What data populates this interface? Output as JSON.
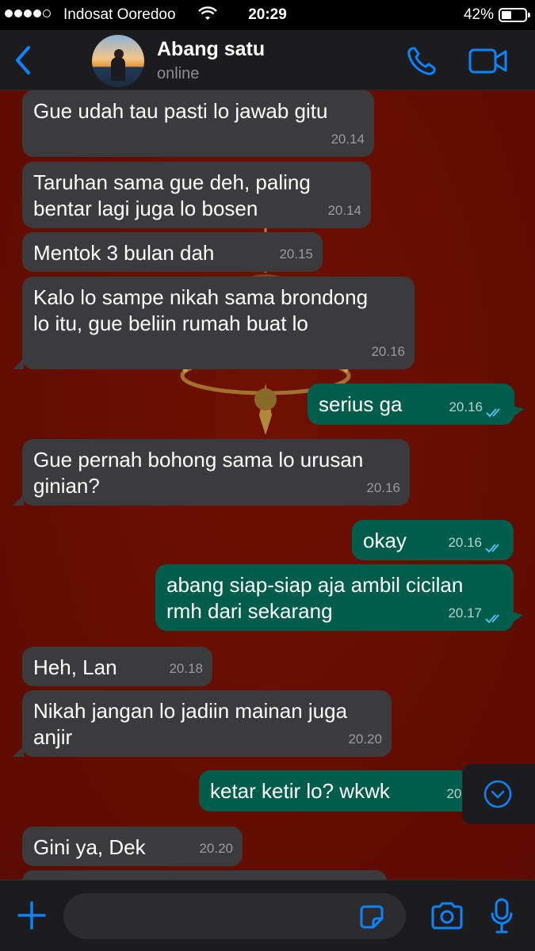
{
  "status_bar": {
    "carrier": "Indosat Ooredoo",
    "time": "20:29",
    "battery_pct": "42%"
  },
  "header": {
    "contact_name": "Abang satu",
    "contact_status": "online"
  },
  "messages": [
    {
      "dir": "in",
      "text": "Gue udah tau pasti lo jawab gitu",
      "time": "20.14"
    },
    {
      "dir": "in",
      "text": "Taruhan sama gue deh, paling\nbentar lagi juga lo bosen",
      "time": "20.14"
    },
    {
      "dir": "in",
      "text": "Mentok 3 bulan dah",
      "time": "20.15"
    },
    {
      "dir": "in",
      "text": "Kalo lo sampe nikah sama brondong\nlo itu, gue beliin rumah buat lo",
      "time": "20.16"
    },
    {
      "dir": "out",
      "text": "serius ga",
      "time": "20.16"
    },
    {
      "dir": "in",
      "text": "Gue pernah bohong sama lo urusan\nginian?",
      "time": "20.16"
    },
    {
      "dir": "out",
      "text": "okay",
      "time": "20.16"
    },
    {
      "dir": "out",
      "text": "abang siap-siap aja ambil cicilan\nrmh dari sekarang",
      "time": "20.17"
    },
    {
      "dir": "in",
      "text": "Heh, Lan",
      "time": "20.18"
    },
    {
      "dir": "in",
      "text": "Nikah jangan lo jadiin mainan juga\nanjir",
      "time": "20.20"
    },
    {
      "dir": "out",
      "text": "ketar ketir lo? wkwk",
      "time": "20."
    },
    {
      "dir": "in",
      "text": "Gini ya, Dek",
      "time": "20.20"
    }
  ],
  "input": {
    "placeholder": ""
  },
  "colors": {
    "accent": "#0a84ff",
    "incoming_bubble": "#3b3b3d",
    "outgoing_bubble": "#005c4b",
    "wallpaper": "#6a0d02",
    "read_tick": "#53bdeb"
  },
  "icons": [
    "back-chevron-icon",
    "phone-icon",
    "video-camera-icon",
    "chevron-down-icon",
    "plus-icon",
    "sticker-icon",
    "camera-icon",
    "microphone-icon",
    "double-check-icon"
  ]
}
